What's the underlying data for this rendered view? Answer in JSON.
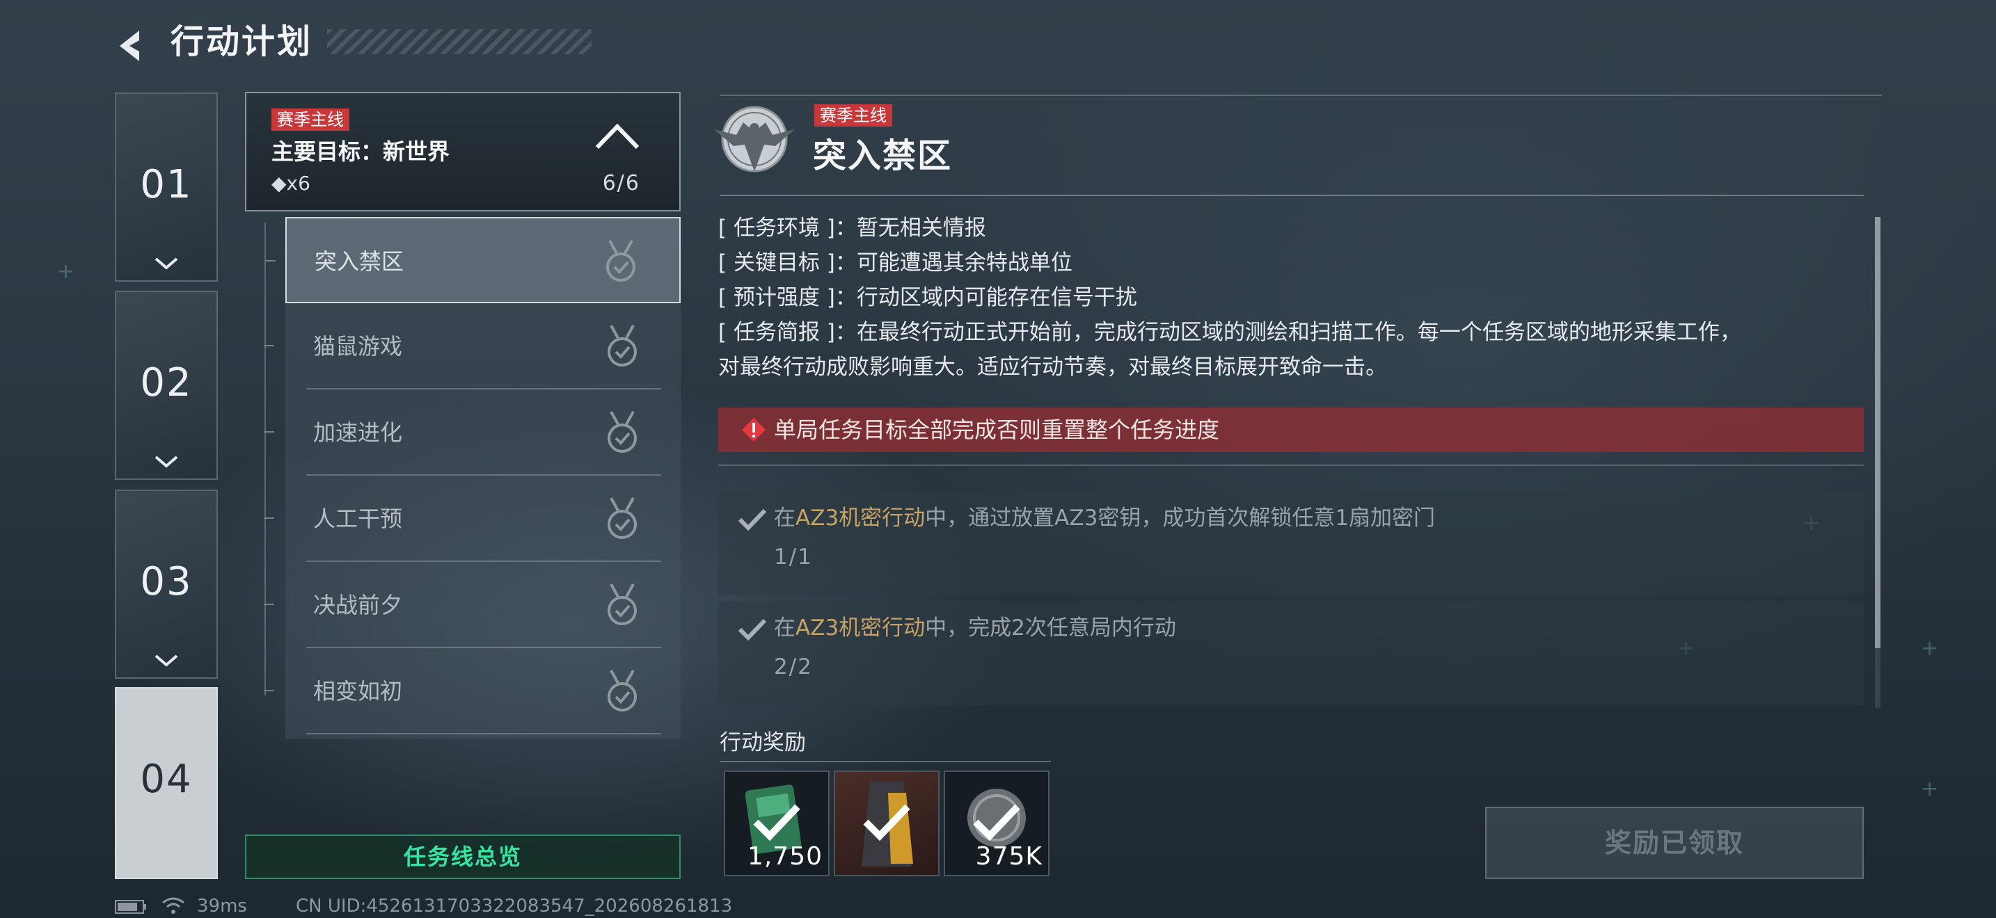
{
  "header": {
    "title": "行动计划"
  },
  "chapters": [
    {
      "num": "01",
      "active": false
    },
    {
      "num": "02",
      "active": false
    },
    {
      "num": "03",
      "active": false
    },
    {
      "num": "04",
      "active": true
    }
  ],
  "mission_header": {
    "badge": "赛季主线",
    "title": "主要目标：新世界",
    "count": "◆x6",
    "progress": "6/6"
  },
  "missions": [
    {
      "label": "突入禁区",
      "selected": true
    },
    {
      "label": "猫鼠游戏",
      "selected": false
    },
    {
      "label": "加速进化",
      "selected": false
    },
    {
      "label": "人工干预",
      "selected": false
    },
    {
      "label": "决战前夕",
      "selected": false
    },
    {
      "label": "相变如初",
      "selected": false
    }
  ],
  "overview_button": "任务线总览",
  "status": {
    "ping": "39ms",
    "uid": "CN UID:4526131703322083547_202608261813"
  },
  "detail": {
    "badge": "赛季主线",
    "title": "突入禁区",
    "info": {
      "env": "[ 任务环境 ]：暂无相关情报",
      "target": "[ 关键目标 ]：可能遭遇其余特战单位",
      "strength": "[ 预计强度 ]：行动区域内可能存在信号干扰",
      "brief": "[ 任务简报 ]：在最终行动正式开始前，完成行动区域的测绘和扫描工作。每一个任务区域的地形采集工作，",
      "brief2": "对最终行动成败影响重大。适应行动节奏，对最终目标展开致命一击。"
    },
    "warning": "单局任务目标全部完成否则重置整个任务进度",
    "objectives": [
      {
        "pre": "在",
        "highlight": "AZ3机密行动",
        "post": "中，通过放置AZ3密钥，成功首次解锁任意1扇加密门",
        "progress": "1/1"
      },
      {
        "pre": "在",
        "highlight": "AZ3机密行动",
        "post": "中，完成2次任意局内行动",
        "progress": "2/2"
      }
    ]
  },
  "rewards": {
    "label": "行动奖励",
    "items": [
      {
        "qty": "1,750",
        "icon": "currency-card-icon"
      },
      {
        "qty": "",
        "icon": "cape-icon"
      },
      {
        "qty": "375K",
        "icon": "coin-icon"
      }
    ]
  },
  "claimed_button": "奖励已领取",
  "colors": {
    "accent_green": "#35e3a3",
    "badge_red": "#c8373a",
    "warning_red": "#962d32",
    "highlight_gold": "#c6a464"
  }
}
